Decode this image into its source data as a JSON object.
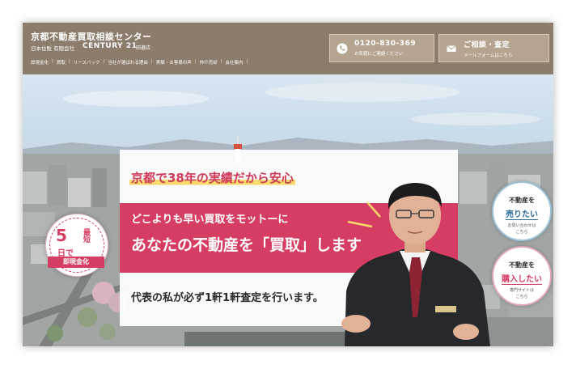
{
  "header": {
    "site_title": "京都不動産買取相談センター",
    "company": "日本住販 有限会社",
    "brand": "CENTURY 21",
    "branch": "田邉店",
    "nav": [
      "即現金化",
      "買取",
      "リースバック",
      "当社が選ばれる理由",
      "実績・お客様の声",
      "仲介売却",
      "会社案内"
    ],
    "phone": {
      "number": "0120-830-369",
      "sub": "お気軽にご連絡ください",
      "icon": "phone-icon"
    },
    "mail": {
      "title": "ご相談・査定",
      "sub": "メールフォームはこちら",
      "icon": "mail-icon"
    }
  },
  "hero": {
    "tagline": "京都で38年の実績だから安心",
    "line1": "どこよりも早い買取をモットーに",
    "line2": "あなたの不動産を「買取」します",
    "desc": "代表の私が必ず1軒1軒査定を行います。",
    "badge": {
      "short": "最短",
      "days": "5",
      "unit": "日で",
      "ribbon": "即現金化"
    },
    "sell": {
      "line1": "不動産を",
      "line2": "売りたい",
      "line3": "お問い合わせは",
      "line4": "こちら"
    },
    "buy": {
      "line1": "不動産を",
      "line2": "購入したい",
      "line3": "専門サイトは",
      "line4": "こちら"
    }
  },
  "colors": {
    "header_bg": "#8b7c6b",
    "accent_pink": "#d63d63",
    "highlight_yellow": "#f8d96b",
    "cta_bg": "#b5a48f"
  }
}
